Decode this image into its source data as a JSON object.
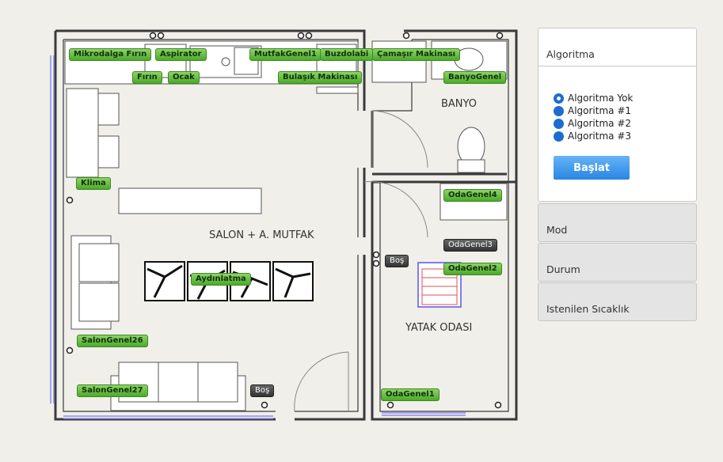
{
  "floorplan": {
    "room_labels": {
      "salon": "SALON + A. MUTFAK",
      "banyo": "BANYO",
      "yatak": "YATAK ODASI"
    },
    "devices": {
      "mikrodalga": "Mikrodalga Fırın",
      "aspirator": "Aspirator",
      "mutfakgenel1": "MutfakGenel1",
      "buzdolabi": "Buzdolabi",
      "camasir": "Çamaşır Makinası",
      "firin": "Fırın",
      "ocak": "Ocak",
      "bulasik": "Bulaşık Makinası",
      "banyogenel": "BanyoGenel",
      "klima": "Klima",
      "odagenel4": "OdaGenel4",
      "odagenel3": "OdaGenel3",
      "odagenel2": "OdaGenel2",
      "bos1": "Boş",
      "aydinlatma": "Aydınlatma",
      "salongenel26": "SalonGenel26",
      "salongenel27": "SalonGenel27",
      "bos2": "Boş",
      "odagenel1": "OdaGenel1"
    }
  },
  "sidebar": {
    "algorithm": {
      "title": "Algoritma",
      "options": [
        "Algoritma Yok",
        "Algoritma #1",
        "Algoritma #2",
        "Algoritma #3"
      ],
      "selected_index": 0,
      "start_button": "Başlat"
    },
    "mode_title": "Mod",
    "status_title": "Durum",
    "desired_temp_title": "Istenilen Sıcaklık"
  },
  "colors": {
    "accent": "#1d6ccf",
    "tag_green": "#5cb634",
    "wall": "#3a3a3a",
    "background": "#f1efe9"
  }
}
